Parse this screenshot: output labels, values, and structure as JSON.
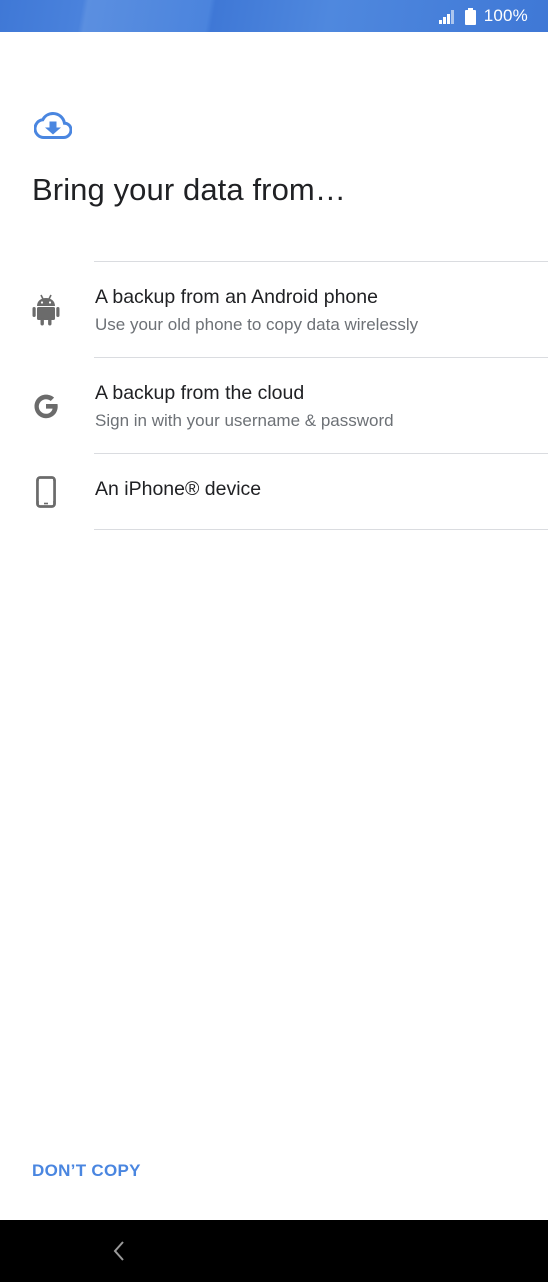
{
  "status_bar": {
    "battery_text": "100%"
  },
  "header": {
    "title": "Bring your data from…"
  },
  "options": [
    {
      "title": "A backup from an Android phone",
      "subtitle": "Use your old phone to copy data wirelessly",
      "icon": "android-icon"
    },
    {
      "title": "A backup from the cloud",
      "subtitle": "Sign in with your username & password",
      "icon": "google-g-icon"
    },
    {
      "title": "An iPhone® device",
      "icon": "smartphone-icon"
    }
  ],
  "footer": {
    "dont_copy_label": "DON’T COPY"
  },
  "colors": {
    "accent": "#4a86e0",
    "status_bar": "#3f78d6",
    "text_primary": "#202124",
    "text_secondary": "#6d7176",
    "divider": "#dadce0",
    "icon_gray": "#6b6b6b"
  }
}
